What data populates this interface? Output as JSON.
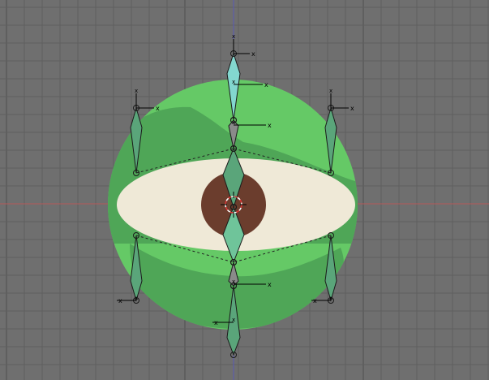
{
  "viewport": {
    "view": "front-orthographic",
    "background_color": "#6f6f6f",
    "grid_minor_color": "#5f5f5f",
    "grid_major_color": "#4f4f4f",
    "axis_x_color": "#b55a5a",
    "axis_z_color": "#5a5ab5"
  },
  "scene": {
    "objects": [
      {
        "type": "sphere-mesh",
        "name": "eyeball"
      },
      {
        "type": "armature",
        "name": "eye-rig"
      }
    ],
    "colors": {
      "sphere_light": "#65c966",
      "sphere_dark": "#4fa657",
      "sclera": "#efe9d7",
      "iris": "#6b3d2d",
      "bone_fill": "#5aa57a",
      "bone_selected": "#83d7cf",
      "bone_gray": "#8a8a8a",
      "bone_outline": "#1a1a1a"
    }
  },
  "gizmo": {
    "axis_label": "x"
  }
}
